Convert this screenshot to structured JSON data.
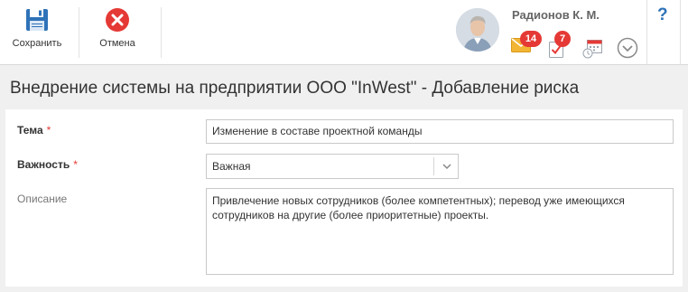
{
  "toolbar": {
    "save_label": "Сохранить",
    "cancel_label": "Отмена",
    "save_icon": "floppy-disk-icon",
    "cancel_icon": "close-circle-icon"
  },
  "user": {
    "name": "Радионов К. М.",
    "mail_count": "14",
    "tasks_count": "7"
  },
  "help_label": "?",
  "page": {
    "title": "Внедрение системы на предприятии ООО \"InWest\" - Добавление риска"
  },
  "form": {
    "topic": {
      "label": "Тема",
      "required_mark": "*",
      "value": "Изменение в составе проектной команды"
    },
    "importance": {
      "label": "Важность",
      "required_mark": "*",
      "value": "Важная"
    },
    "description": {
      "label": "Описание",
      "value": "Привлечение новых сотрудников (более компетентных); перевод уже имеющихся сотрудников на другие (более приоритетные) проекты."
    }
  },
  "colors": {
    "accent_blue": "#2f73b8",
    "badge_red": "#e53935",
    "background_gray": "#f0f0f0"
  }
}
